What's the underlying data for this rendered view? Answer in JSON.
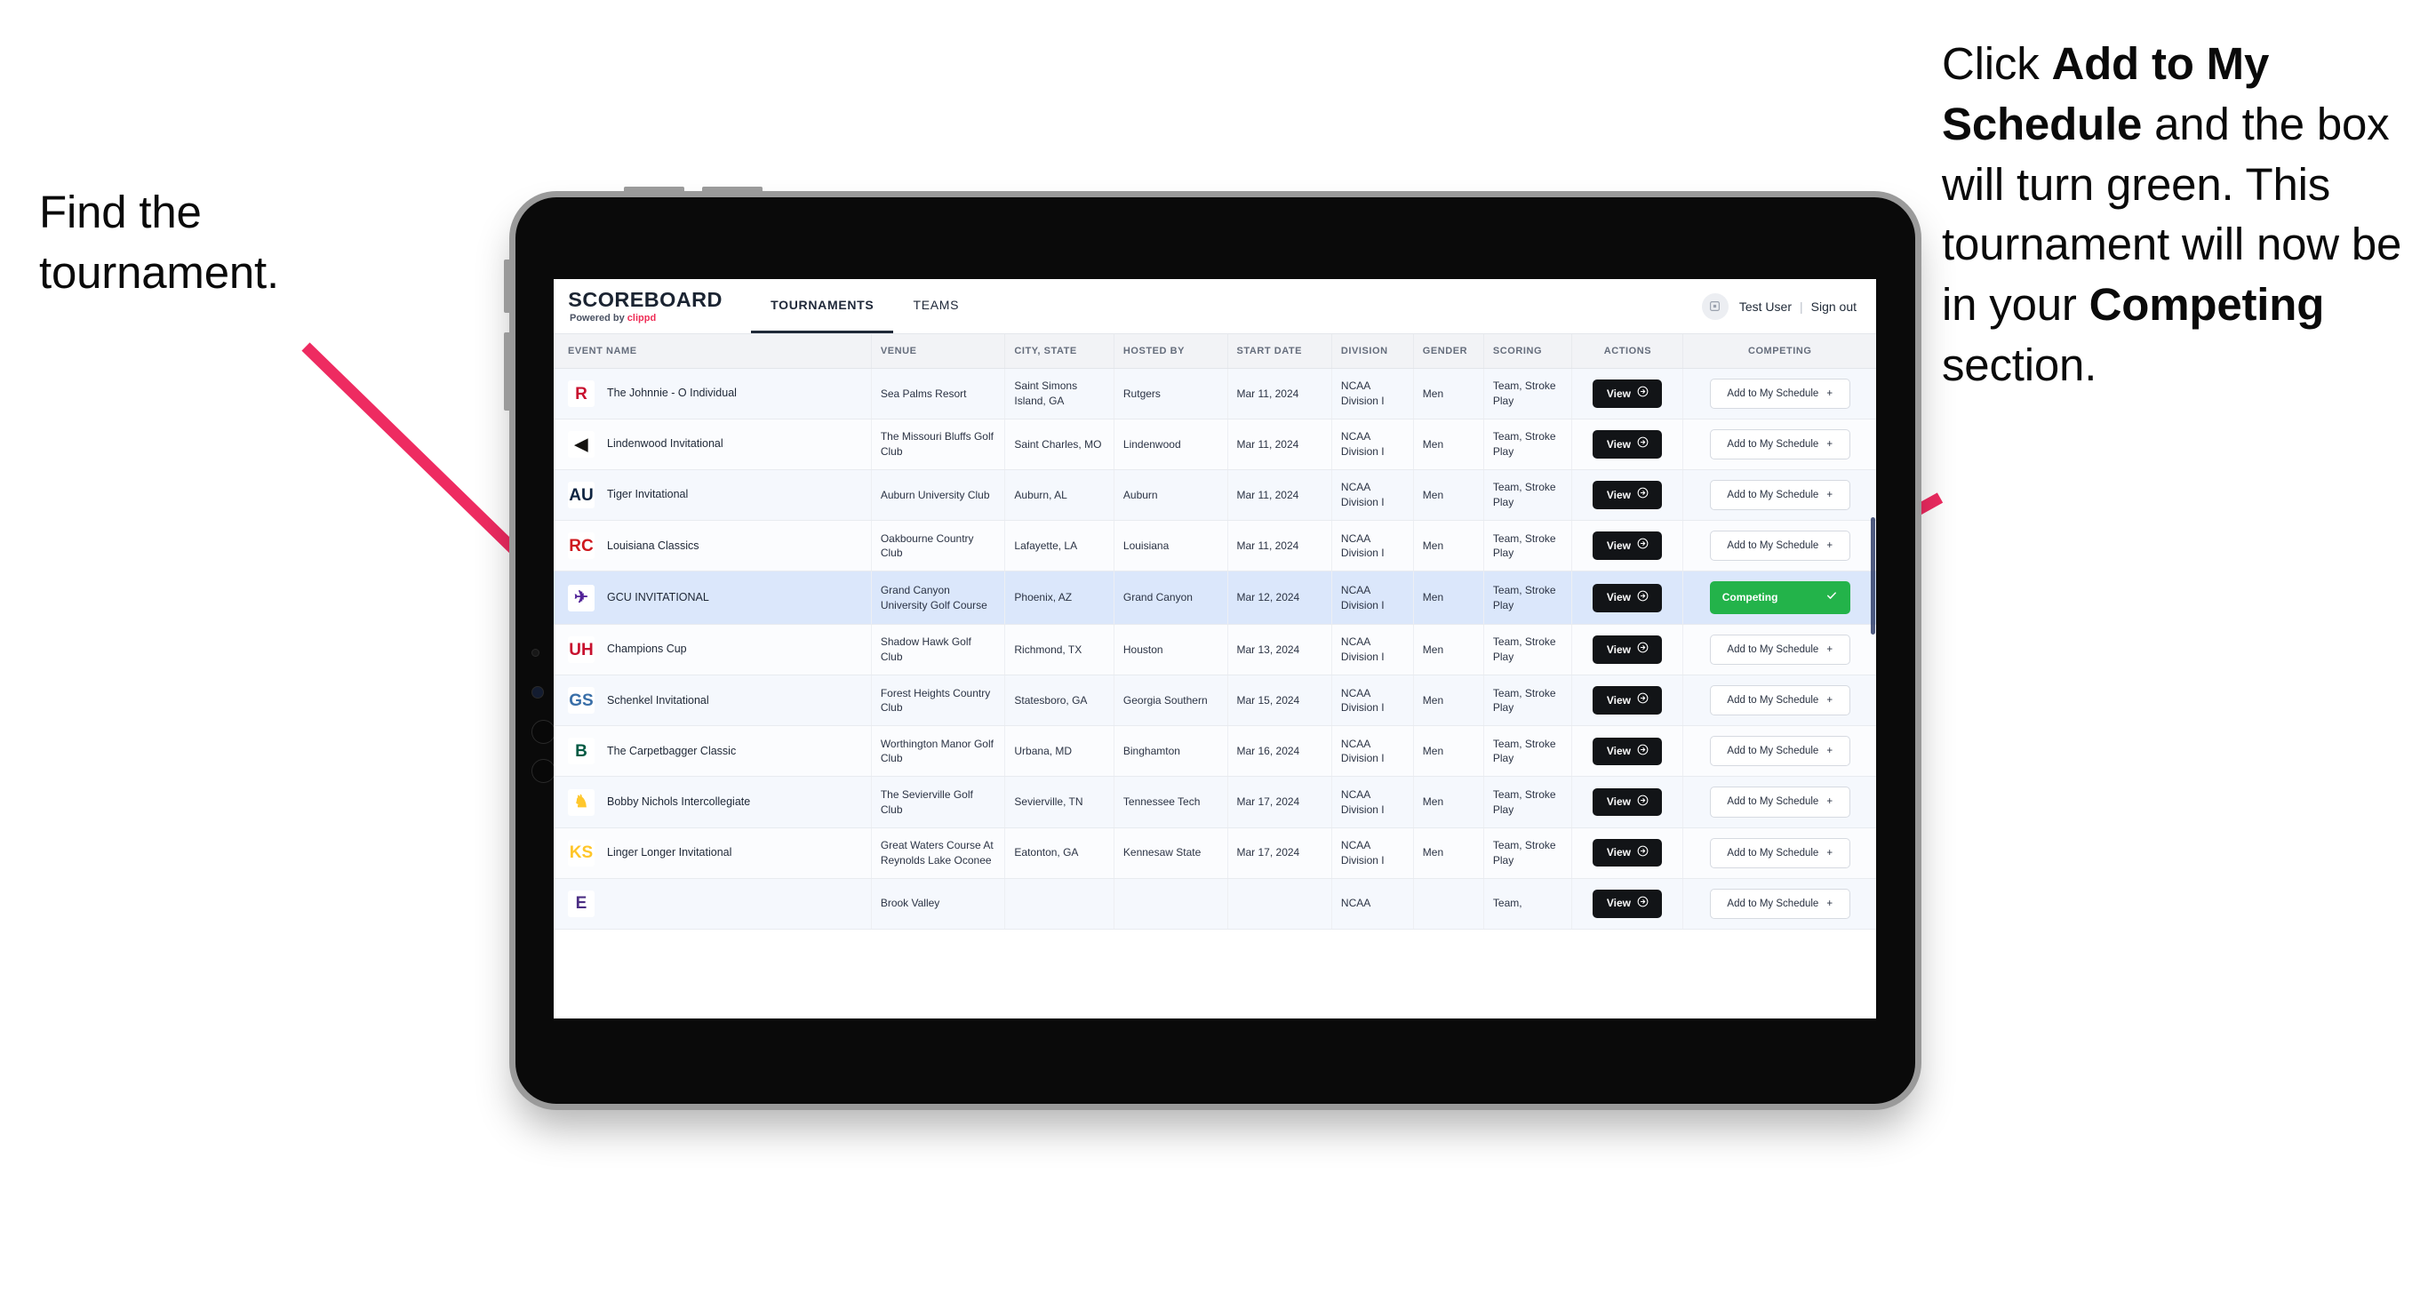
{
  "annotations": {
    "left": {
      "line1": "Find the",
      "line2": "tournament."
    },
    "right": {
      "part1": "Click ",
      "bold1": "Add to My Schedule",
      "part2": " and the box will turn green. This tournament will now be in your ",
      "bold2": "Competing",
      "part3": " section."
    },
    "arrow_color": "#EE2B61"
  },
  "app": {
    "brand": {
      "title": "SCOREBOARD",
      "powered_prefix": "Powered by ",
      "powered_brand": "clippd"
    },
    "nav": [
      {
        "label": "TOURNAMENTS",
        "active": true
      },
      {
        "label": "TEAMS",
        "active": false
      }
    ],
    "header_right": {
      "avatar_icon": "user-avatar-icon",
      "user_name": "Test User",
      "separator": "|",
      "sign_out": "Sign out"
    }
  },
  "table": {
    "columns": [
      "EVENT NAME",
      "VENUE",
      "CITY, STATE",
      "HOSTED BY",
      "START DATE",
      "DIVISION",
      "GENDER",
      "SCORING",
      "ACTIONS",
      "COMPETING"
    ],
    "labels": {
      "view": "View",
      "add": "Add to My Schedule",
      "competing": "Competing",
      "add_icon": "plus-icon",
      "view_icon": "arrow-circle-right-icon",
      "competing_icon": "check-icon"
    },
    "rows": [
      {
        "logo": "R",
        "logo_bg": "#ffffff",
        "logo_fg": "#c8102e",
        "event": "The Johnnie - O Individual",
        "venue": "Sea Palms Resort",
        "city": "Saint Simons Island, GA",
        "host": "Rutgers",
        "date": "Mar 11, 2024",
        "division": "NCAA Division I",
        "gender": "Men",
        "scoring": "Team, Stroke Play",
        "competing": false
      },
      {
        "logo": "◀",
        "logo_bg": "#ffffff",
        "logo_fg": "#14120f",
        "event": "Lindenwood Invitational",
        "venue": "The Missouri Bluffs Golf Club",
        "city": "Saint Charles, MO",
        "host": "Lindenwood",
        "date": "Mar 11, 2024",
        "division": "NCAA Division I",
        "gender": "Men",
        "scoring": "Team, Stroke Play",
        "competing": false
      },
      {
        "logo": "AU",
        "logo_bg": "#ffffff",
        "logo_fg": "#0c2340",
        "event": "Tiger Invitational",
        "venue": "Auburn University Club",
        "city": "Auburn, AL",
        "host": "Auburn",
        "date": "Mar 11, 2024",
        "division": "NCAA Division I",
        "gender": "Men",
        "scoring": "Team, Stroke Play",
        "competing": false
      },
      {
        "logo": "RC",
        "logo_bg": "#ffffff",
        "logo_fg": "#ce181e",
        "event": "Louisiana Classics",
        "venue": "Oakbourne Country Club",
        "city": "Lafayette, LA",
        "host": "Louisiana",
        "date": "Mar 11, 2024",
        "division": "NCAA Division I",
        "gender": "Men",
        "scoring": "Team, Stroke Play",
        "competing": false
      },
      {
        "logo": "✈",
        "logo_bg": "#ffffff",
        "logo_fg": "#522398",
        "event": "GCU INVITATIONAL",
        "venue": "Grand Canyon University Golf Course",
        "city": "Phoenix, AZ",
        "host": "Grand Canyon",
        "date": "Mar 12, 2024",
        "division": "NCAA Division I",
        "gender": "Men",
        "scoring": "Team, Stroke Play",
        "competing": true,
        "highlight": true
      },
      {
        "logo": "UH",
        "logo_bg": "#ffffff",
        "logo_fg": "#c8102e",
        "event": "Champions Cup",
        "venue": "Shadow Hawk Golf Club",
        "city": "Richmond, TX",
        "host": "Houston",
        "date": "Mar 13, 2024",
        "division": "NCAA Division I",
        "gender": "Men",
        "scoring": "Team, Stroke Play",
        "competing": false
      },
      {
        "logo": "GS",
        "logo_bg": "#ffffff",
        "logo_fg": "#3a6fa8",
        "event": "Schenkel Invitational",
        "venue": "Forest Heights Country Club",
        "city": "Statesboro, GA",
        "host": "Georgia Southern",
        "date": "Mar 15, 2024",
        "division": "NCAA Division I",
        "gender": "Men",
        "scoring": "Team, Stroke Play",
        "competing": false
      },
      {
        "logo": "B",
        "logo_bg": "#ffffff",
        "logo_fg": "#005a43",
        "event": "The Carpetbagger Classic",
        "venue": "Worthington Manor Golf Club",
        "city": "Urbana, MD",
        "host": "Binghamton",
        "date": "Mar 16, 2024",
        "division": "NCAA Division I",
        "gender": "Men",
        "scoring": "Team, Stroke Play",
        "competing": false
      },
      {
        "logo": "♞",
        "logo_bg": "#ffffff",
        "logo_fg": "#ffc72c",
        "event": "Bobby Nichols Intercollegiate",
        "venue": "The Sevierville Golf Club",
        "city": "Sevierville, TN",
        "host": "Tennessee Tech",
        "date": "Mar 17, 2024",
        "division": "NCAA Division I",
        "gender": "Men",
        "scoring": "Team, Stroke Play",
        "competing": false
      },
      {
        "logo": "KS",
        "logo_bg": "#ffffff",
        "logo_fg": "#ffc629",
        "event": "Linger Longer Invitational",
        "venue": "Great Waters Course At Reynolds Lake Oconee",
        "city": "Eatonton, GA",
        "host": "Kennesaw State",
        "date": "Mar 17, 2024",
        "division": "NCAA Division I",
        "gender": "Men",
        "scoring": "Team, Stroke Play",
        "competing": false
      },
      {
        "logo": "E",
        "logo_bg": "#ffffff",
        "logo_fg": "#4b2e83",
        "event": "",
        "venue": "Brook Valley",
        "city": "",
        "host": "",
        "date": "",
        "division": "NCAA",
        "gender": "",
        "scoring": "Team,",
        "competing": false,
        "partial": true
      }
    ]
  }
}
